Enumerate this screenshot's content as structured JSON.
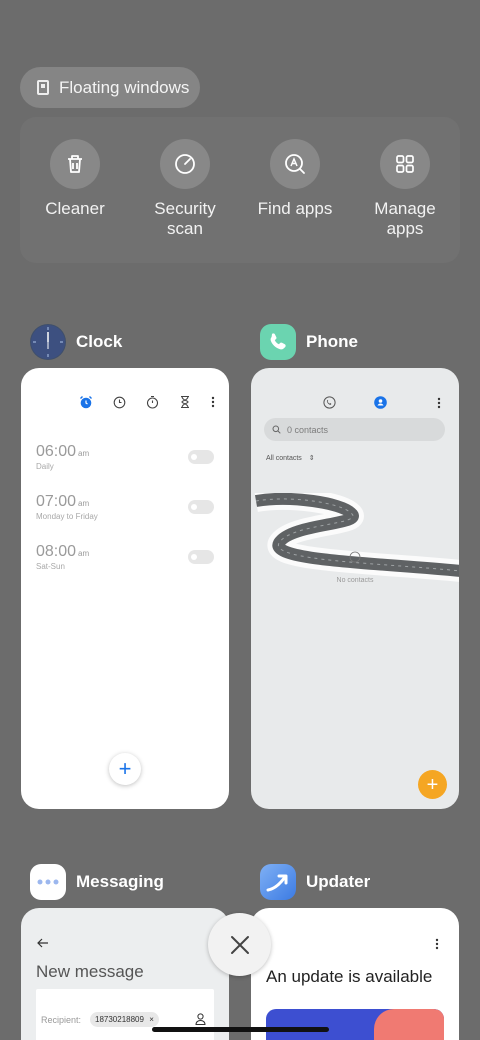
{
  "floating_windows": {
    "label": "Floating windows",
    "icon": "floating-window-icon"
  },
  "quick_actions": [
    {
      "label": "Cleaner",
      "icon": "trash-icon"
    },
    {
      "label": "Security\nscan",
      "icon": "security-scan-icon"
    },
    {
      "label": "Find apps",
      "icon": "find-apps-icon"
    },
    {
      "label": "Manage\napps",
      "icon": "grid-icon"
    }
  ],
  "apps": {
    "clock": {
      "name": "Clock",
      "accent": "#1a73e8",
      "alarms": [
        {
          "time": "06:00",
          "ampm": "am",
          "repeat": "Daily",
          "enabled": false
        },
        {
          "time": "07:00",
          "ampm": "am",
          "repeat": "Monday to Friday",
          "enabled": false
        },
        {
          "time": "08:00",
          "ampm": "am",
          "repeat": "Sat-Sun",
          "enabled": false
        }
      ],
      "fab": "+"
    },
    "phone": {
      "name": "Phone",
      "icon_color": "#6bd4b0",
      "search_placeholder": "0 contacts",
      "filter": "All contacts",
      "empty_text": "No contacts",
      "fab": "+",
      "fab_color": "#f5a623"
    },
    "messaging": {
      "name": "Messaging",
      "title": "New message",
      "recipient_label": "Recipient:",
      "recipient_chip": "18730218809"
    },
    "updater": {
      "name": "Updater",
      "heading": "An update is available"
    }
  },
  "close_icon": "close-icon"
}
